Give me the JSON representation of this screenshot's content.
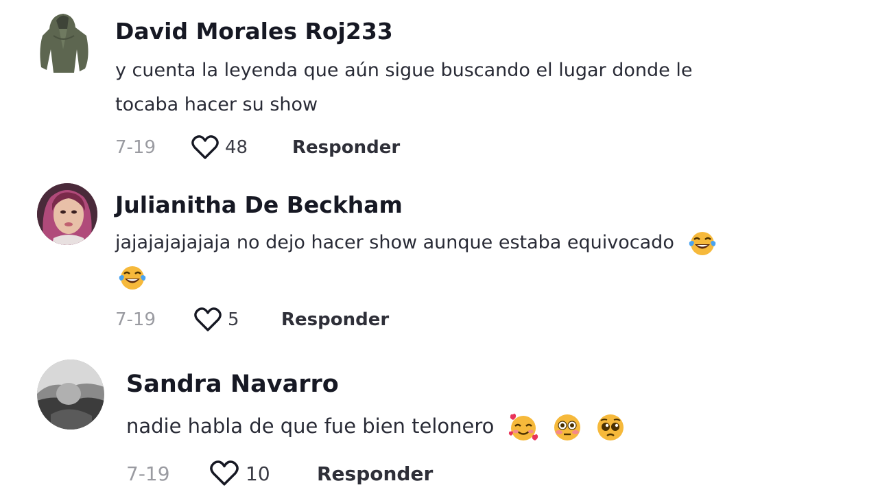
{
  "comments": [
    {
      "username": "David Morales Roj233",
      "text_line1": "y cuenta la leyenda que aún sigue buscando el lugar donde le",
      "text_line2": "tocaba hacer su show",
      "date": "7-19",
      "likes": "48",
      "reply_label": "Responder",
      "avatar_icon": "man-green-shirt-avatar"
    },
    {
      "username": "Julianitha De Beckham",
      "text_line1": "jajajajajajaja no dejo hacer show aunque estaba equivocado",
      "emojis_line1": [
        "tears-of-joy-emoji"
      ],
      "emojis_line2": [
        "tears-of-joy-emoji"
      ],
      "date": "7-19",
      "likes": "5",
      "reply_label": "Responder",
      "avatar_icon": "woman-selfie-avatar"
    },
    {
      "username": "Sandra Navarro",
      "text_line1": "nadie habla de que fue bien telonero",
      "emojis_line1": [
        "smiling-face-with-hearts-emoji",
        "flushed-face-emoji",
        "pleading-face-emoji"
      ],
      "date": "7-19",
      "likes": "10",
      "reply_label": "Responder",
      "avatar_icon": "grayscale-photo-avatar"
    }
  ],
  "colors": {
    "username": "#161823",
    "text": "#292b36",
    "date": "#9a9ba1",
    "reply": "#2e2f38"
  }
}
